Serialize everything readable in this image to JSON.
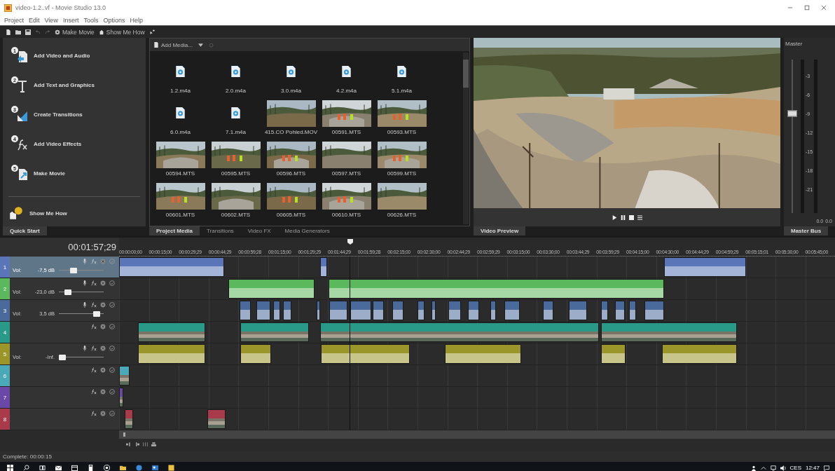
{
  "window": {
    "title": "video-1.2..vf - Movie Studio 13.0"
  },
  "menu": [
    "Project",
    "Edit",
    "View",
    "Insert",
    "Tools",
    "Options",
    "Help"
  ],
  "toolbar": {
    "make_movie": "Make Movie",
    "show_me_how": "Show Me How"
  },
  "quick_start": {
    "items": [
      {
        "number": "1",
        "label": "Add Video and Audio",
        "kind": "media"
      },
      {
        "number": "2",
        "label": "Add Text and Graphics",
        "kind": "text"
      },
      {
        "number": "3",
        "label": "Create Transitions",
        "kind": "transition"
      },
      {
        "number": "4",
        "label": "Add Video Effects",
        "kind": "effects"
      },
      {
        "number": "5",
        "label": "Make Movie",
        "kind": "movie"
      }
    ],
    "help": "Show Me How",
    "tab": "Quick Start"
  },
  "media": {
    "add_media": "Add Media...",
    "items": [
      {
        "name": "1.2.m4a",
        "kind": "audio"
      },
      {
        "name": "2.0.m4a",
        "kind": "audio"
      },
      {
        "name": "3.0.m4a",
        "kind": "audio"
      },
      {
        "name": "4.2.m4a",
        "kind": "audio"
      },
      {
        "name": "5.1.m4a",
        "kind": "audio"
      },
      {
        "name": "6.0.m4a",
        "kind": "audio"
      },
      {
        "name": "7.1.m4a",
        "kind": "audio"
      },
      {
        "name": "415.CO Pohled.MOV",
        "kind": "video"
      },
      {
        "name": "00591.MTS",
        "kind": "video"
      },
      {
        "name": "00593.MTS",
        "kind": "video"
      },
      {
        "name": "00594.MTS",
        "kind": "video"
      },
      {
        "name": "00595.MTS",
        "kind": "video"
      },
      {
        "name": "00596.MTS",
        "kind": "video"
      },
      {
        "name": "00597.MTS",
        "kind": "video"
      },
      {
        "name": "00599.MTS",
        "kind": "video"
      },
      {
        "name": "00601.MTS",
        "kind": "video"
      },
      {
        "name": "00602.MTS",
        "kind": "video"
      },
      {
        "name": "00605.MTS",
        "kind": "video"
      },
      {
        "name": "00610.MTS",
        "kind": "video"
      },
      {
        "name": "00626.MTS",
        "kind": "video"
      }
    ],
    "tabs": [
      {
        "label": "Project Media",
        "selected": true
      },
      {
        "label": "Transitions",
        "selected": false
      },
      {
        "label": "Video FX",
        "selected": false
      },
      {
        "label": "Media Generators",
        "selected": false
      }
    ]
  },
  "preview": {
    "tab": "Video Preview"
  },
  "master": {
    "title": "Master",
    "scale": [
      "-3",
      "-6",
      "-9",
      "-12",
      "-15",
      "-18",
      "-21"
    ],
    "readings": [
      "0.0",
      "0.0"
    ],
    "level": 0.65,
    "tab": "Master Bus"
  },
  "timeline": {
    "timecode": "00:01:57;29",
    "ruler": [
      "00:00:00;00",
      "00:00:15;00",
      "00:00:29;29",
      "00:00:44;29",
      "00:00:59;28",
      "00:01:15;00",
      "00:01:29;29",
      "00:01:44;29",
      "00:01:59;28",
      "00:02:15;00",
      "00:02:30;00",
      "00:02:44;29",
      "00:02:59;29",
      "00:03:15;00",
      "00:03:30;00",
      "00:03:44;29",
      "00:03:59;29",
      "00:04:15;00",
      "00:04:30;00",
      "00:04:44;29",
      "00:04:59;29",
      "00:05:15;01",
      "00:05:30;00",
      "00:05:45;00"
    ],
    "tracks": [
      {
        "number": "1",
        "kind": "audio",
        "color": "#5a76b8",
        "selected": true,
        "vol_label": "Vol:",
        "volume": "-7,5 dB",
        "level": 0.3
      },
      {
        "number": "2",
        "kind": "audio",
        "color": "#5cb85c",
        "selected": false,
        "vol_label": "Vol:",
        "volume": "-23,0 dB",
        "level": 0.15
      },
      {
        "number": "3",
        "kind": "audio",
        "color": "#4a6a9c",
        "selected": false,
        "vol_label": "Vol:",
        "volume": "3,5 dB",
        "level": 0.9
      },
      {
        "number": "4",
        "kind": "video",
        "color": "#2a9a88",
        "selected": false
      },
      {
        "number": "5",
        "kind": "audio",
        "color": "#9a962a",
        "selected": false,
        "vol_label": "Vol:",
        "volume": "-Inf.",
        "level": 0.0
      },
      {
        "number": "6",
        "kind": "video",
        "color": "#4aa8b8",
        "selected": false
      },
      {
        "number": "7",
        "kind": "video",
        "color": "#6a48a8",
        "selected": false
      },
      {
        "number": "8",
        "kind": "video",
        "color": "#a83a4c",
        "selected": false
      }
    ]
  },
  "status_bar": "Complete: 00:00:15",
  "taskbar": {
    "language": "CES",
    "time": "12:47"
  }
}
